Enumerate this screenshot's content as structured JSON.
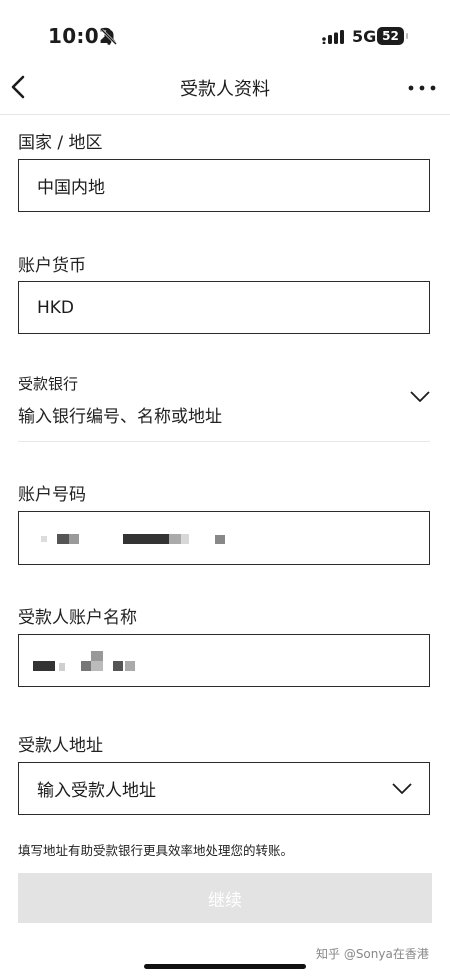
{
  "status": {
    "time": "10:02",
    "network": "5G",
    "battery": "52"
  },
  "nav": {
    "title": "受款人资料"
  },
  "form": {
    "country_label": "国家 / 地区",
    "country_value": "中国内地",
    "currency_label": "账户货币",
    "currency_value": "HKD",
    "bank_label": "受款银行",
    "bank_placeholder": "输入银行编号、名称或地址",
    "account_number_label": "账户号码",
    "account_name_label": "受款人账户名称",
    "address_label": "受款人地址",
    "address_placeholder": "输入受款人地址",
    "hint": "填写地址有助受款银行更具效率地处理您的转账。",
    "continue_label": "继续"
  },
  "watermark": "知乎 @Sonya在香港",
  "icons": [
    "bell-off-icon",
    "signal-icon",
    "battery-icon",
    "back-arrow-icon",
    "more-icon",
    "chevron-down-icon"
  ]
}
